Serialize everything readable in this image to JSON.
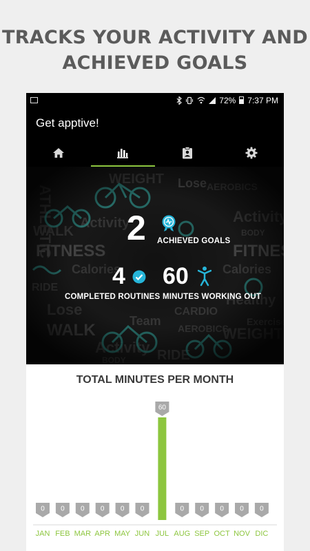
{
  "headline": {
    "line1": "TRACKS YOUR ACTIVITY AND",
    "line2": "ACHIEVED GOALS"
  },
  "statusbar": {
    "battery_pct": "72%",
    "time": "7:37 PM",
    "icons": [
      "gallery-icon",
      "bluetooth-icon",
      "vibrate-icon",
      "wifi-icon",
      "signal-icon",
      "battery-icon"
    ]
  },
  "app": {
    "title": "Get apptive!"
  },
  "tabs": [
    {
      "name": "home",
      "icon": "home-icon",
      "active": false
    },
    {
      "name": "stats",
      "icon": "bar-chart-icon",
      "active": true
    },
    {
      "name": "routines",
      "icon": "clipboard-icon",
      "active": false
    },
    {
      "name": "settings",
      "icon": "gear-icon",
      "active": false
    }
  ],
  "stats": {
    "achieved_goals": {
      "value": "2",
      "label": "ACHIEVED GOALS"
    },
    "completed_routines": {
      "value": "4",
      "label": "COMPLETED ROUTINES"
    },
    "minutes_working_out": {
      "value": "60",
      "label": "MINUTES WORKING OUT"
    }
  },
  "colors": {
    "accent_green": "#8dc63f",
    "badge_blue": "#26b5d9",
    "badge_grey": "#a9a9a9",
    "month_label_green": "#8dc63f"
  },
  "chart_data": {
    "type": "bar",
    "title": "TOTAL MINUTES PER MONTH",
    "categories": [
      "JAN",
      "FEB",
      "MAR",
      "APR",
      "MAY",
      "JUN",
      "JUL",
      "AUG",
      "SEP",
      "OCT",
      "NOV",
      "DIC"
    ],
    "values": [
      0,
      0,
      0,
      0,
      0,
      0,
      60,
      0,
      0,
      0,
      0,
      0
    ],
    "ylim": [
      0,
      60
    ],
    "xlabel": "",
    "ylabel": "",
    "grid": false,
    "data_labels": true
  }
}
